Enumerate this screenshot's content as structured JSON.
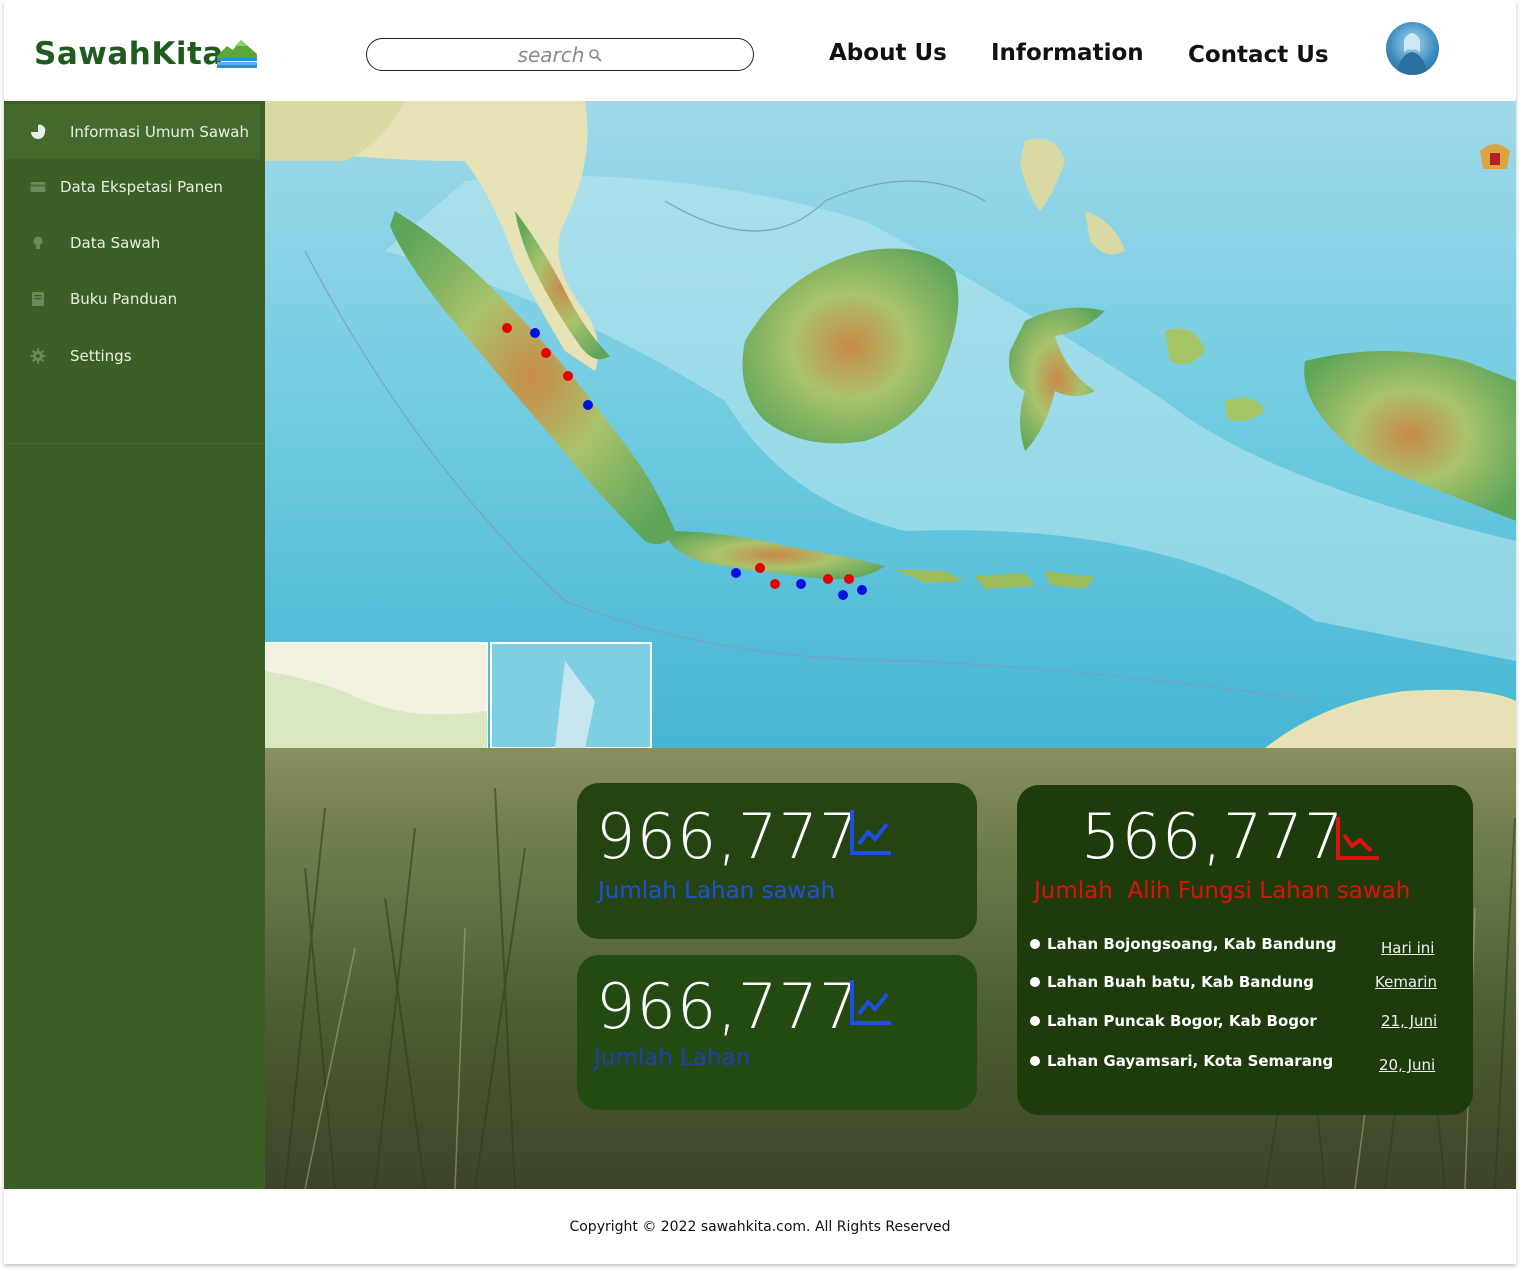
{
  "header": {
    "brand": "SawahKita",
    "search_placeholder": "search",
    "nav": [
      "About Us",
      "Information",
      "Contact Us"
    ]
  },
  "sidebar": {
    "items": [
      {
        "label": "Informasi Umum Sawah",
        "icon": "pie-chart-icon",
        "active": true
      },
      {
        "label": "Data Ekspetasi Panen",
        "icon": "card-icon",
        "active": false
      },
      {
        "label": "Data Sawah",
        "icon": "lightbulb-icon",
        "active": false
      },
      {
        "label": "Buku Panduan",
        "icon": "book-icon",
        "active": false
      },
      {
        "label": "Settings",
        "icon": "gear-icon",
        "active": false
      }
    ]
  },
  "stats": {
    "card1": {
      "value": "966,777",
      "label": "Jumlah Lahan sawah",
      "trend": "up",
      "color": "#1f4fe0"
    },
    "card2": {
      "value": "966,777",
      "label": "Jumlah Lahan",
      "trend": "up",
      "color": "#1f4fe0"
    },
    "card3": {
      "value": "566,777",
      "label": "Jumlah  Alih Fungsi Lahan sawah",
      "trend": "down",
      "color": "#e01010",
      "items": [
        {
          "name": "Lahan Bojongsoang, Kab Bandung",
          "date": "Hari ini"
        },
        {
          "name": "Lahan Buah batu, Kab Bandung",
          "date": "Kemarin"
        },
        {
          "name": "Lahan Puncak Bogor, Kab Bogor",
          "date": "21, Juni"
        },
        {
          "name": "Lahan Gayamsari, Kota Semarang",
          "date": "20, Juni"
        }
      ]
    }
  },
  "footer": {
    "copyright": "Copyright © 2022 sawahkita.com. All Rights Reserved"
  },
  "colors": {
    "sidebar": "#3b5f25",
    "brand": "#1f5a1f",
    "marker_red": "#e50000",
    "marker_blue": "#0010e0"
  }
}
